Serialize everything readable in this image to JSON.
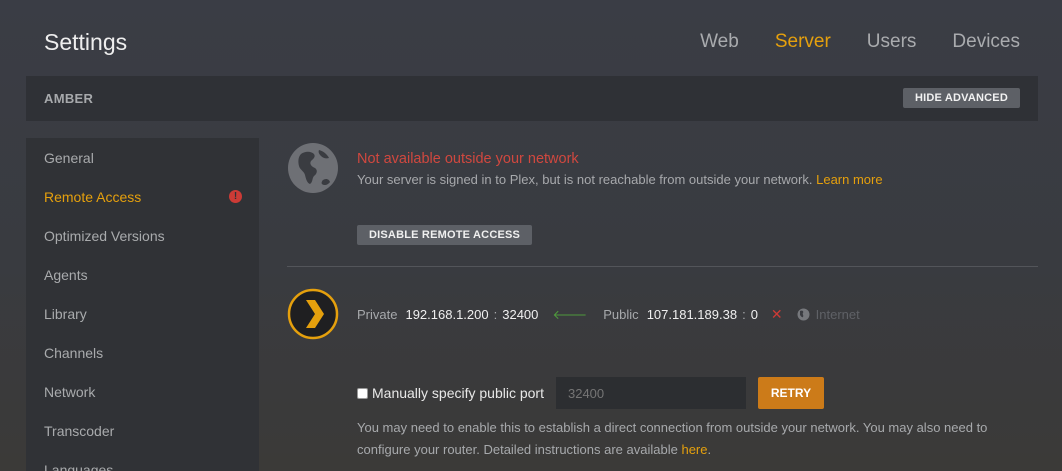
{
  "header": {
    "title": "Settings",
    "tabs": [
      {
        "label": "Web",
        "active": false
      },
      {
        "label": "Server",
        "active": true
      },
      {
        "label": "Users",
        "active": false
      },
      {
        "label": "Devices",
        "active": false
      }
    ]
  },
  "serverbar": {
    "server_name": "AMBER",
    "hide_advanced_label": "HIDE ADVANCED"
  },
  "sidebar": {
    "items": [
      {
        "label": "General"
      },
      {
        "label": "Remote Access",
        "active": true,
        "alert": "!"
      },
      {
        "label": "Optimized Versions"
      },
      {
        "label": "Agents"
      },
      {
        "label": "Library"
      },
      {
        "label": "Channels"
      },
      {
        "label": "Network"
      },
      {
        "label": "Transcoder"
      },
      {
        "label": "Languages"
      }
    ]
  },
  "remote": {
    "status_title": "Not available outside your network",
    "status_desc": "Your server is signed in to Plex, but is not reachable from outside your network.",
    "learn_more": "Learn more",
    "disable_label": "DISABLE REMOTE ACCESS",
    "private_label": "Private",
    "private_ip": "192.168.1.200",
    "private_port": "32400",
    "public_label": "Public",
    "public_ip": "107.181.189.38",
    "public_port": "0",
    "colon": ":",
    "arrow_glyph": "🡐",
    "x_glyph": "✕",
    "internet_label": "Internet",
    "manual_port_label": "Manually specify public port",
    "port_placeholder": "32400",
    "retry_label": "RETRY",
    "help_text": "You may need to enable this to establish a direct connection from outside your network. You may also need to configure your router. Detailed instructions are available",
    "help_link": "here",
    "help_end": "."
  },
  "colors": {
    "accent": "#e5a00d",
    "error": "#d0483f",
    "success": "#4f9a3c",
    "retry": "#cc7b19"
  },
  "icons": {
    "globe": "globe-icon",
    "plex": "plex-chevron-icon",
    "arrow": "arrow-left-icon",
    "error": "close-icon",
    "internet": "globe-small-icon"
  }
}
